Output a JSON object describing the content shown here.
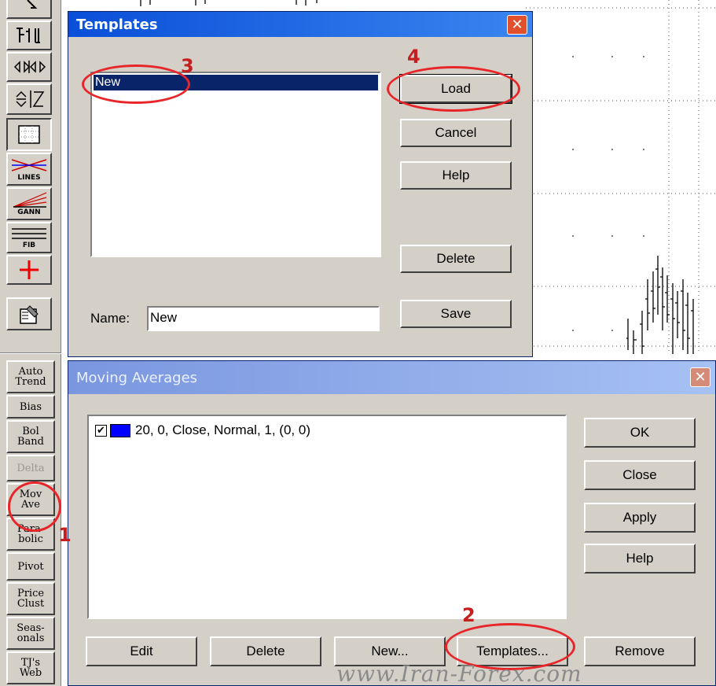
{
  "toolbar": {
    "text_buttons": [
      {
        "label": "Auto\nTrend"
      },
      {
        "label": "Bias"
      },
      {
        "label": "Bol\nBand"
      },
      {
        "label": "Delta"
      },
      {
        "label": "Mov\nAve"
      },
      {
        "label": "Para-\nbolic"
      },
      {
        "label": "Pivot"
      },
      {
        "label": "Price\nClust"
      },
      {
        "label": "Seas-\nonals"
      },
      {
        "label": "TJ's\nWeb"
      }
    ],
    "icon_labels": {
      "lines": "LINES",
      "gann": "GANN",
      "fib": "FIB"
    }
  },
  "templates_dialog": {
    "title": "Templates",
    "list_items": [
      "New"
    ],
    "buttons": {
      "load": "Load",
      "cancel": "Cancel",
      "help": "Help",
      "delete": "Delete",
      "save": "Save"
    },
    "name_label": "Name:",
    "name_value": "New"
  },
  "moving_averages_dialog": {
    "title": "Moving Averages",
    "items": [
      {
        "checked": true,
        "color": "#0000ff",
        "label": "20, 0, Close, Normal, 1, (0, 0)"
      }
    ],
    "side_buttons": {
      "ok": "OK",
      "close": "Close",
      "apply": "Apply",
      "help": "Help"
    },
    "bottom_buttons": {
      "edit": "Edit",
      "delete": "Delete",
      "new": "New...",
      "templates": "Templates...",
      "remove": "Remove"
    }
  },
  "annotations": {
    "step1": "1",
    "step2": "2",
    "step3": "3",
    "step4": "4",
    "color": "#e8262a"
  },
  "watermark": {
    "url": "www.Iran-Forex.com"
  }
}
